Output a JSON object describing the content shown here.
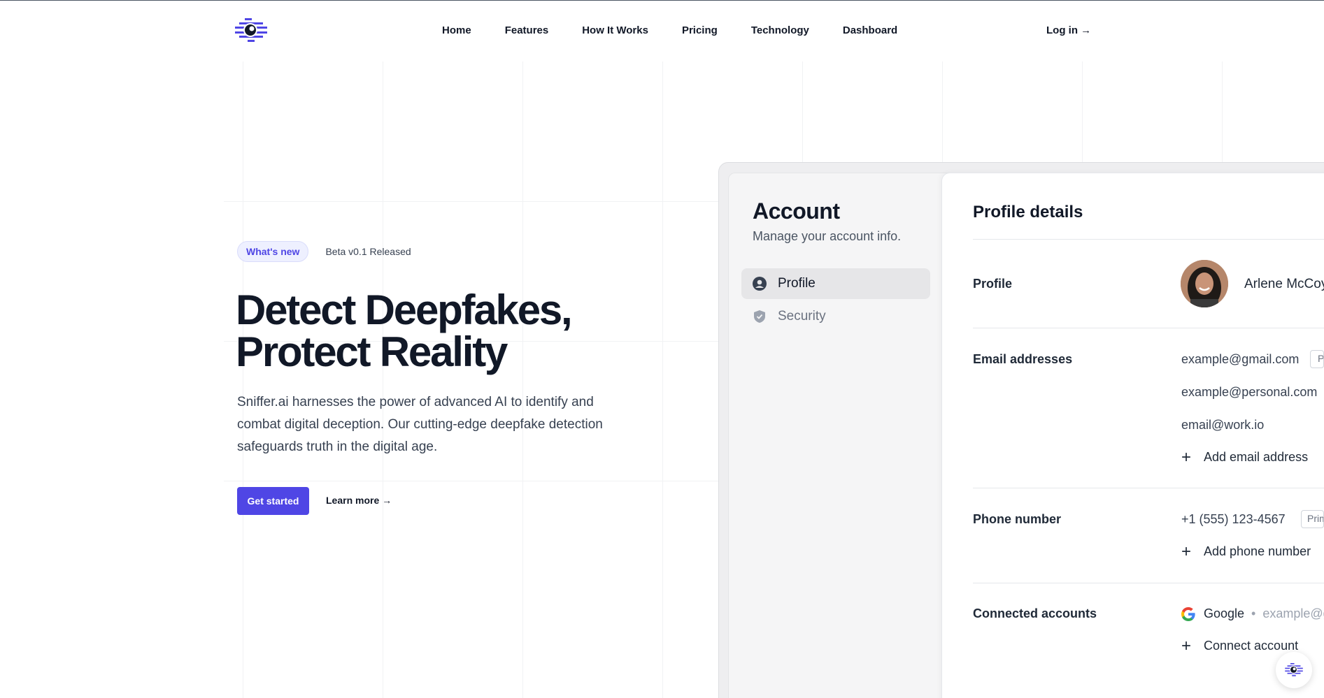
{
  "nav": {
    "links": [
      "Home",
      "Features",
      "How It Works",
      "Pricing",
      "Technology",
      "Dashboard"
    ],
    "login": "Log in →"
  },
  "hero": {
    "badge": "What's new",
    "badge_text": "Beta v0.1 Released",
    "title_line1": "Detect Deepfakes,",
    "title_line2": "Protect Reality",
    "description": "Sniffer.ai harnesses the power of advanced AI to identify and combat digital deception. Our cutting-edge deepfake detection safeguards truth in the digital age.",
    "primary_cta": "Get started",
    "secondary_cta": "Learn more →"
  },
  "account": {
    "title": "Account",
    "subtitle": "Manage your account info.",
    "nav": [
      {
        "label": "Profile",
        "icon": "user-circle-icon",
        "active": true
      },
      {
        "label": "Security",
        "icon": "shield-icon",
        "active": false
      }
    ]
  },
  "profile": {
    "title": "Profile details",
    "profile_label": "Profile",
    "name": "Arlene McCoy",
    "email_label": "Email addresses",
    "emails": [
      "example@gmail.com",
      "example@personal.com",
      "email@work.io"
    ],
    "email_tag": "Primary",
    "add_email": "Add email address",
    "phone_label": "Phone number",
    "phone": "+1 (555) 123-4567",
    "phone_tag": "Primary",
    "add_phone": "Add phone number",
    "connected_label": "Connected accounts",
    "connected_provider": "Google",
    "connected_email": "example@gmail.com",
    "connect_account": "Connect account"
  },
  "colors": {
    "brand": "#4f46e5",
    "text": "#111827"
  }
}
